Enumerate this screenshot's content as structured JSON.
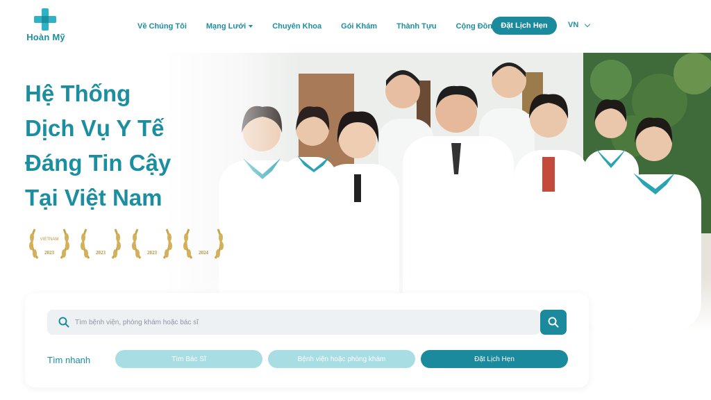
{
  "brand": {
    "name": "Hoàn Mỹ"
  },
  "nav": {
    "items": [
      {
        "label": "Về Chúng Tôi",
        "has_dropdown": false
      },
      {
        "label": "Mạng Lưới",
        "has_dropdown": true
      },
      {
        "label": "Chuyên Khoa",
        "has_dropdown": false
      },
      {
        "label": "Gói Khám",
        "has_dropdown": false
      },
      {
        "label": "Thành Tựu",
        "has_dropdown": false
      },
      {
        "label": "Cộng Đồng",
        "has_dropdown": false
      }
    ],
    "cta_label": "Đặt Lịch Hẹn",
    "language": "VN"
  },
  "hero": {
    "headline": [
      "Hệ Thống",
      "Dịch Vụ Y Tế",
      "Đáng Tin Cậy",
      "Tại Việt Nam"
    ],
    "awards": [
      {
        "icon": "award-laurel-icon",
        "line": "VIETNAM",
        "year": "2023"
      },
      {
        "icon": "award-laurel-icon",
        "line": "",
        "year": "2023"
      },
      {
        "icon": "award-laurel-icon",
        "line": "",
        "year": "2023"
      },
      {
        "icon": "award-laurel-icon",
        "line": "",
        "year": "2024"
      }
    ]
  },
  "search": {
    "placeholder": "Tìm bệnh viện, phòng khám hoặc bác sĩ",
    "quick_label": "Tìm nhanh",
    "quick_buttons": [
      {
        "label": "Tìm Bác Sĩ",
        "style": "light"
      },
      {
        "label": "Bệnh viện hoặc phòng khám",
        "style": "light"
      },
      {
        "label": "Đặt Lịch Hẹn",
        "style": "dark"
      }
    ]
  },
  "colors": {
    "primary": "#1a8a9c",
    "accent": "#2db3c3",
    "light_pill": "#a7dde3",
    "gold": "#c9a44a"
  }
}
